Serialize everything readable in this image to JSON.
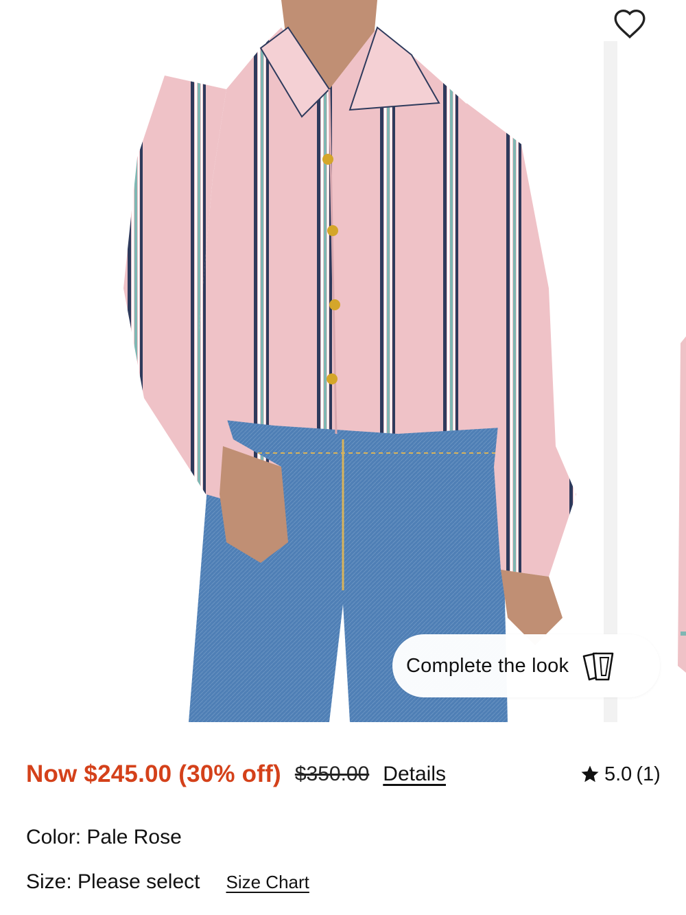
{
  "gallery": {
    "favorite_icon": "heart-outline-icon",
    "complete_look": {
      "label": "Complete the look",
      "icon": "cards-icon"
    }
  },
  "product": {
    "price_now": "Now $245.00 (30% off)",
    "price_was": "$350.00",
    "details_label": "Details",
    "rating": {
      "icon": "star-icon",
      "value": "5.0",
      "count": "(1)"
    },
    "color": {
      "label": "Color:",
      "value": "Pale Rose"
    },
    "size": {
      "label": "Size:",
      "value": "Please select",
      "chart_label": "Size Chart"
    }
  },
  "colors": {
    "sale_price": "#d4411a",
    "shirt": "#efc2c7",
    "denim": "#4f7fb5"
  }
}
